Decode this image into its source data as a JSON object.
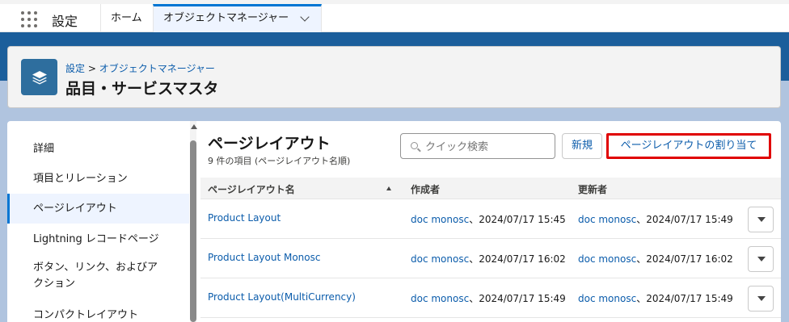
{
  "app": {
    "name": "設定"
  },
  "nav": {
    "tabs": [
      {
        "label": "ホーム"
      },
      {
        "label": "オブジェクトマネージャー"
      }
    ]
  },
  "header": {
    "breadcrumb_root": "設定",
    "breadcrumb_sep": " > ",
    "breadcrumb_current": "オブジェクトマネージャー",
    "title": "品目・サービスマスタ"
  },
  "sidebar": {
    "items": [
      {
        "label": "詳細"
      },
      {
        "label": "項目とリレーション"
      },
      {
        "label": "ページレイアウト",
        "active": true
      },
      {
        "label": "Lightning レコードページ"
      },
      {
        "label": "ボタン、リンク、およびア"
      },
      {
        "label": "クション"
      },
      {
        "label": "コンパクトレイアウト"
      }
    ]
  },
  "section": {
    "title": "ページレイアウト",
    "subtitle": "9 件の項目 (ページレイアウト名順)",
    "search_placeholder": "クイック検索",
    "new_label": "新規",
    "assign_label": "ページレイアウトの割り当て"
  },
  "table": {
    "columns": [
      "ページレイアウト名",
      "作成者",
      "更新者"
    ],
    "sort": "ascending",
    "rows": [
      {
        "name": "Product Layout",
        "created_by": "doc monosc",
        "created_at": "、2024/07/17 15:45",
        "updated_by": "doc monosc",
        "updated_at": "、2024/07/17 15:49"
      },
      {
        "name": "Product Layout Monosc",
        "created_by": "doc monosc",
        "created_at": "、2024/07/17 16:02",
        "updated_by": "doc monosc",
        "updated_at": "、2024/07/17 16:02"
      },
      {
        "name": "Product Layout(MultiCurrency)",
        "created_by": "doc monosc",
        "created_at": "、2024/07/17 15:49",
        "updated_by": "doc monosc",
        "updated_at": "、2024/07/17 15:49"
      }
    ]
  },
  "colors": {
    "brand": "#0176d3",
    "link": "#0b5cab",
    "highlight_border": "#e00000",
    "object_icon": "#2e6e9e"
  },
  "icons": {
    "app_launcher": "waffle-icon",
    "object": "stack-icon",
    "search": "search-icon",
    "sort": "arrow-up-icon",
    "row_menu": "chevron-down-icon",
    "tab_menu": "chevron-down-icon"
  }
}
